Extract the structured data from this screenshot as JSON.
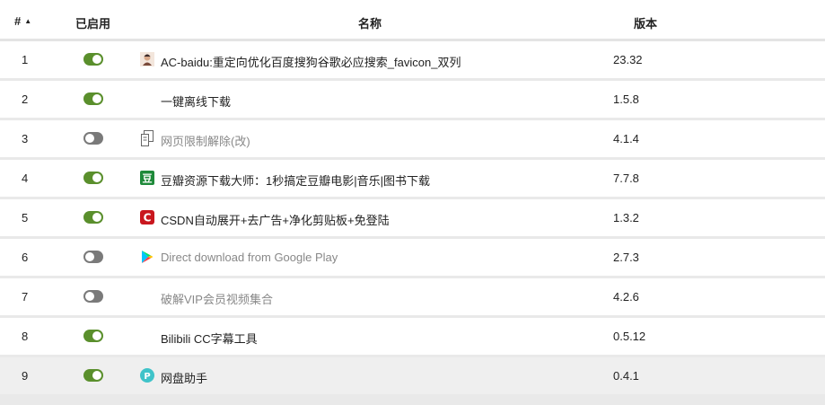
{
  "header": {
    "num": "#",
    "enabled": "已启用",
    "name": "名称",
    "version": "版本",
    "sort_icon": "sort-ascending-icon"
  },
  "rows": [
    {
      "num": "1",
      "enabled": true,
      "icon": "acbaidu-avatar-icon",
      "name": "AC-baidu:重定向优化百度搜狗谷歌必应搜索_favicon_双列",
      "version": "23.32"
    },
    {
      "num": "2",
      "enabled": true,
      "icon": "",
      "name": "一键离线下载",
      "version": "1.5.8"
    },
    {
      "num": "3",
      "enabled": false,
      "icon": "copy-document-icon",
      "name": "网页限制解除(改)",
      "version": "4.1.4"
    },
    {
      "num": "4",
      "enabled": true,
      "icon": "douban-icon",
      "name": "豆瓣资源下载大师：1秒搞定豆瓣电影|音乐|图书下载",
      "version": "7.7.8"
    },
    {
      "num": "5",
      "enabled": true,
      "icon": "csdn-icon",
      "name": "CSDN自动展开+去广告+净化剪贴板+免登陆",
      "version": "1.3.2"
    },
    {
      "num": "6",
      "enabled": false,
      "icon": "google-play-icon",
      "name": "Direct download from Google Play",
      "version": "2.7.3"
    },
    {
      "num": "7",
      "enabled": false,
      "icon": "",
      "name": "破解VIP会员视频集合",
      "version": "4.2.6"
    },
    {
      "num": "8",
      "enabled": true,
      "icon": "",
      "name": "Bilibili CC字幕工具",
      "version": "0.5.12"
    },
    {
      "num": "9",
      "enabled": true,
      "icon": "pan-helper-icon",
      "name": "网盘助手",
      "version": "0.4.1",
      "highlighted": true
    }
  ],
  "colors": {
    "toggle_on": "#5a8f2c",
    "toggle_off": "#7a7a7a",
    "douban_green": "#1f8a3a",
    "csdn_red": "#c9171e",
    "pan_helper_teal": "#3fc3c9"
  }
}
